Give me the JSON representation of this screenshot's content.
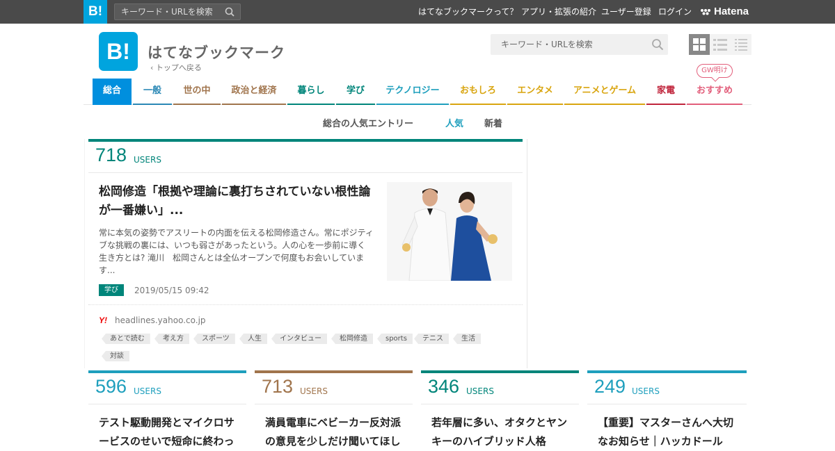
{
  "topbar": {
    "logo": "B!",
    "search_placeholder": "キーワード・URLを検索",
    "links": [
      "はてなブックマークって？",
      "アプリ・拡張の紹介",
      "ユーザー登録",
      "ログイン"
    ],
    "hatena": "Hatena"
  },
  "header": {
    "logo": "B!",
    "title": "はてなブックマーク",
    "back": "‹ トップへ戻る",
    "search_placeholder": "キーワード・URLを検索"
  },
  "categories": [
    {
      "label": "総合",
      "color": "#008fde",
      "active": true
    },
    {
      "label": "一般",
      "color": "#2a88b5"
    },
    {
      "label": "世の中",
      "color": "#a0744c"
    },
    {
      "label": "政治と経済",
      "color": "#a0744c"
    },
    {
      "label": "暮らし",
      "color": "#00857a"
    },
    {
      "label": "学び",
      "color": "#00857a"
    },
    {
      "label": "テクノロジー",
      "color": "#1e9fbd"
    },
    {
      "label": "おもしろ",
      "color": "#d9a50f"
    },
    {
      "label": "エンタメ",
      "color": "#d9a50f"
    },
    {
      "label": "アニメとゲーム",
      "color": "#d9a50f"
    },
    {
      "label": "家電",
      "color": "#c0243b"
    },
    {
      "label": "おすすめ",
      "color": "#e25d7a"
    }
  ],
  "gw_badge": "GW明け",
  "subtabs": {
    "heading": "総合の人気エントリー",
    "popular": "人気",
    "new": "新着"
  },
  "feature": {
    "users": "718",
    "users_label": "USERS",
    "title": "松岡修造「根拠や理論に裏打ちされていない根性論が一番嫌い」...",
    "description": "常に本気の姿勢でアスリートの内面を伝える松岡修造さん。常にポジティブな挑戦の裏には、いつも弱さがあったという。人の心を一歩前に導く生き方とは? 滝川　松岡さんとは全仏オープンで何度もお会いしています...",
    "category": "学び",
    "date": "2019/05/15 09:42",
    "source_icon": "Y!",
    "domain": "headlines.yahoo.co.jp",
    "tags": [
      "あとで読む",
      "考え方",
      "スポーツ",
      "人生",
      "インタビュー",
      "松岡修造",
      "sports",
      "テニス",
      "生活",
      "対談"
    ]
  },
  "cards": [
    {
      "users": "596",
      "users_label": "USERS",
      "title": "テスト駆動開発とマイクロサービスのせいで短命に終わっ",
      "color": "#1e9fbd"
    },
    {
      "users": "713",
      "users_label": "USERS",
      "title": "満員電車にベビーカー反対派の意見を少しだけ聞いてほし",
      "color": "#a0744c"
    },
    {
      "users": "346",
      "users_label": "USERS",
      "title": "若年層に多い、オタクとヤンキーのハイブリッド人格",
      "color": "#00857a"
    },
    {
      "users": "249",
      "users_label": "USERS",
      "title": "【重要】マスターさんへ大切なお知らせ｜ハッカドール",
      "color": "#1e9fbd"
    }
  ]
}
